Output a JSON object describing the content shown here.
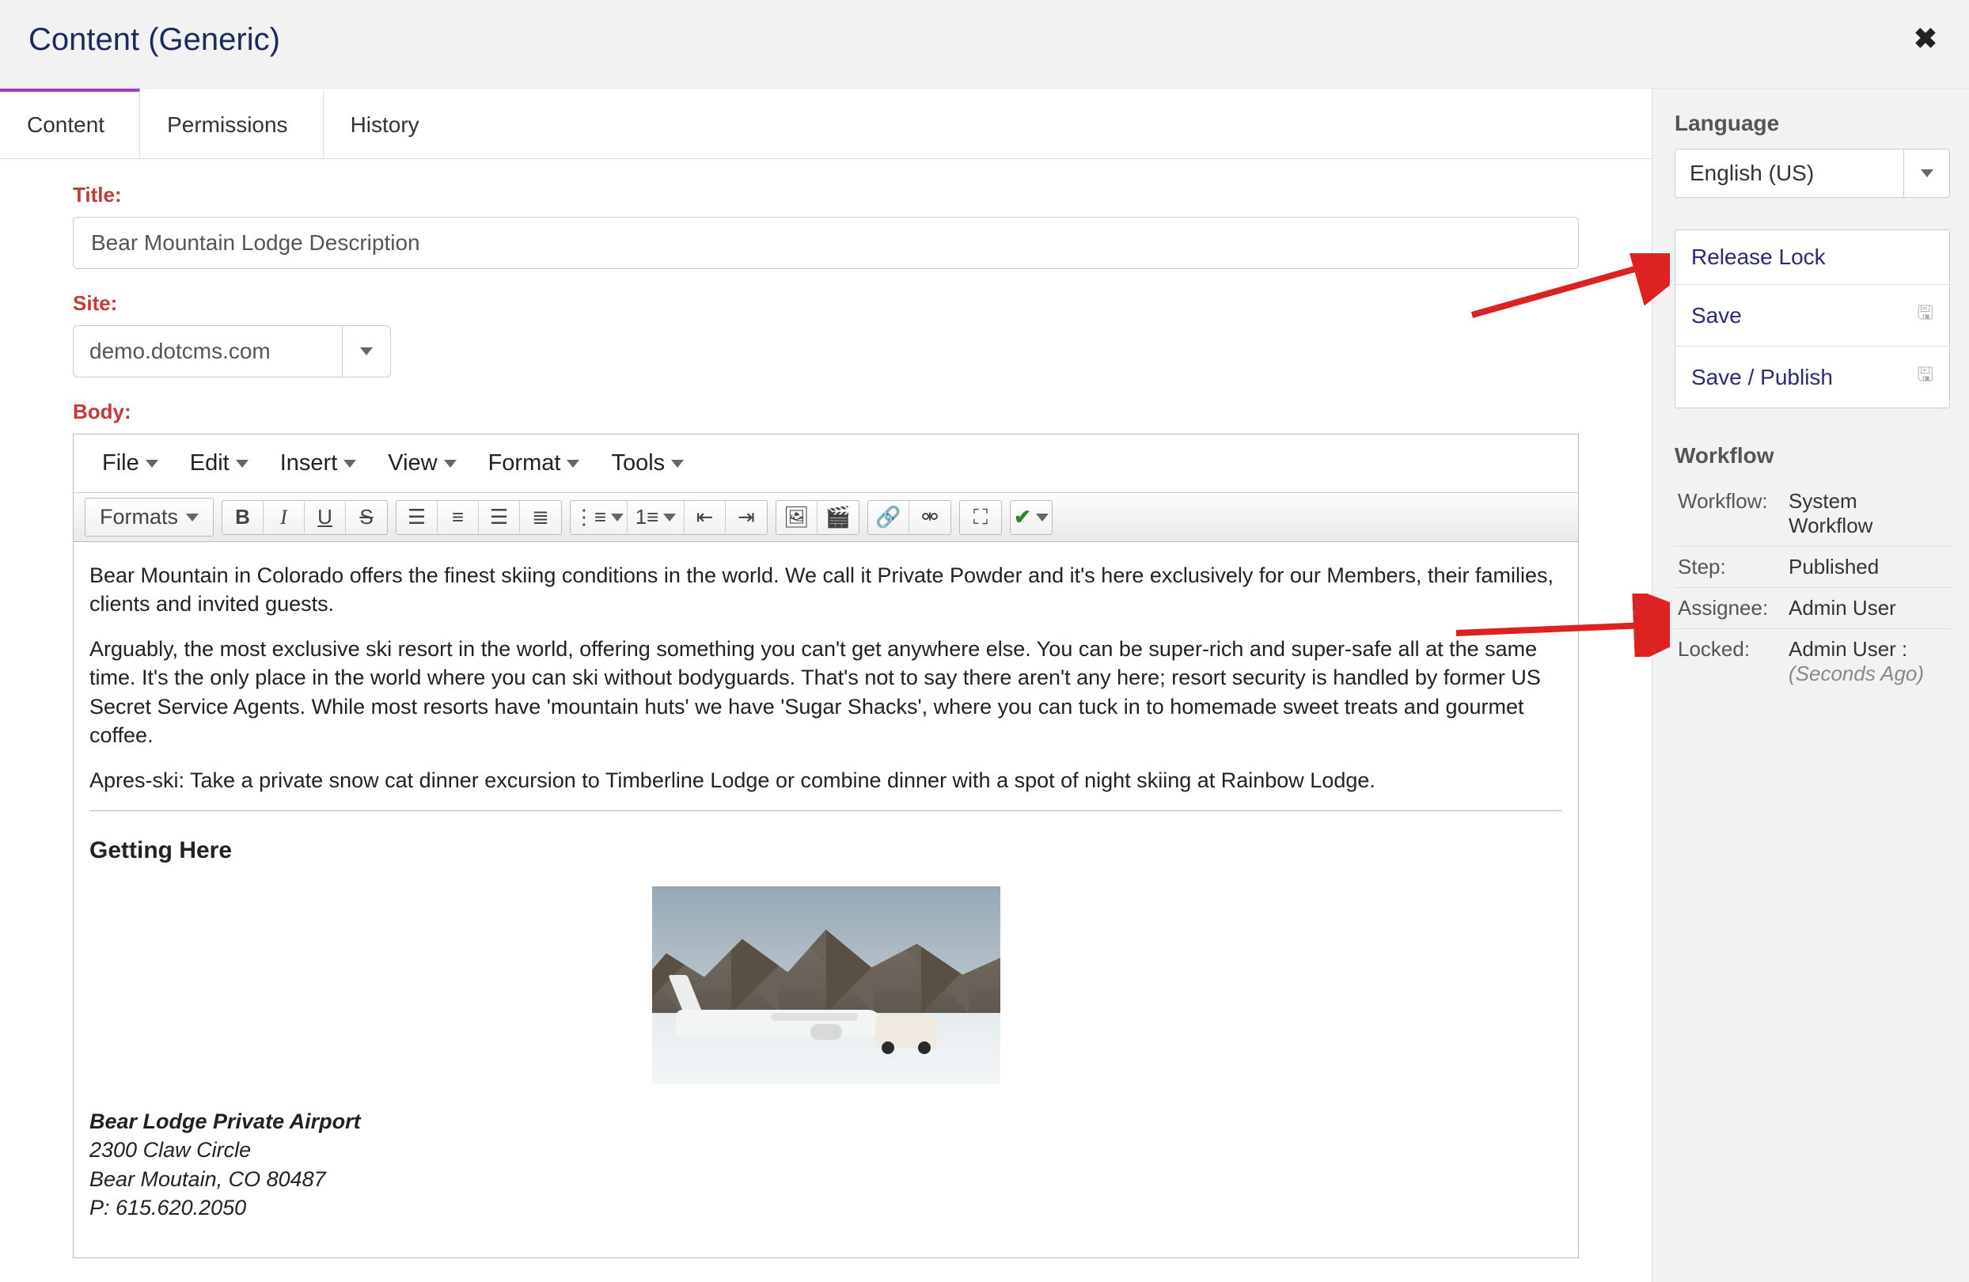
{
  "header": {
    "title": "Content (Generic)"
  },
  "tabs": {
    "content": "Content",
    "permissions": "Permissions",
    "history": "History"
  },
  "form": {
    "title_label": "Title:",
    "title_value": "Bear Mountain Lodge Description",
    "site_label": "Site:",
    "site_value": "demo.dotcms.com",
    "body_label": "Body:"
  },
  "editor": {
    "menu": {
      "file": "File",
      "edit": "Edit",
      "insert": "Insert",
      "view": "View",
      "format": "Format",
      "tools": "Tools"
    },
    "formats_label": "Formats",
    "content": {
      "p1": "Bear Mountain in Colorado offers the finest skiing conditions in the world. We call it Private Powder and it's here exclusively for our Members, their families, clients and invited guests.",
      "p2": "Arguably, the most exclusive ski resort in the world, offering something you can't get anywhere else. You can be super-rich and super-safe all at the same time. It's the only place in the world where you can ski without bodyguards. That's not to say there aren't any here; resort security is handled by former US Secret Service Agents. While most resorts have 'mountain huts' we have 'Sugar Shacks', where you can tuck in to homemade sweet treats and gourmet coffee.",
      "p3": "Apres-ski: Take a private snow cat dinner excursion to Timberline Lodge or combine dinner with a spot of night skiing at Rainbow Lodge.",
      "h3": "Getting Here",
      "addr_name": "Bear Lodge Private Airport",
      "addr_street": "2300 Claw Circle",
      "addr_city": "Bear Moutain, CO 80487",
      "addr_phone": "P: 615.620.2050"
    }
  },
  "sidebar": {
    "language_heading": "Language",
    "language_value": "English (US)",
    "actions": {
      "release_lock": "Release Lock",
      "save": "Save",
      "save_publish": "Save / Publish"
    },
    "workflow_heading": "Workflow",
    "workflow": {
      "workflow_label": "Workflow:",
      "workflow_value": "System Workflow",
      "step_label": "Step:",
      "step_value": "Published",
      "assignee_label": "Assignee:",
      "assignee_value": "Admin User",
      "locked_label": "Locked:",
      "locked_user": "Admin User :",
      "locked_time": "(Seconds Ago)"
    }
  }
}
